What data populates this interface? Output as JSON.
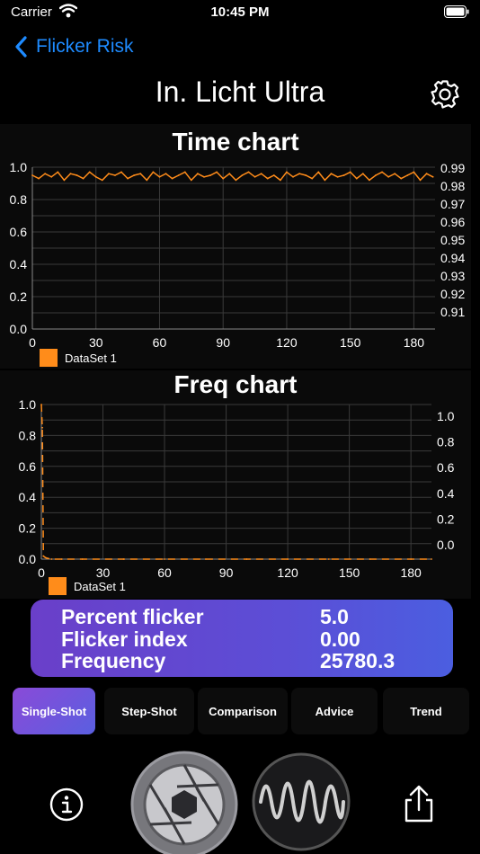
{
  "status": {
    "carrier": "Carrier",
    "time": "10:45 PM"
  },
  "nav": {
    "back_label": "Flicker Risk"
  },
  "title": "In. Licht Ultra",
  "time_chart": {
    "title": "Time chart",
    "left_ticks": [
      "1.0",
      "0.8",
      "0.6",
      "0.4",
      "0.2",
      "0.0"
    ],
    "right_ticks": [
      "0.99",
      "0.98",
      "0.97",
      "0.96",
      "0.95",
      "0.94",
      "0.93",
      "0.92",
      "0.91"
    ],
    "x_ticks": [
      "0",
      "30",
      "60",
      "90",
      "120",
      "150",
      "180"
    ],
    "legend": "DataSet 1"
  },
  "freq_chart": {
    "title": "Freq chart",
    "left_ticks": [
      "1.0",
      "0.8",
      "0.6",
      "0.4",
      "0.2",
      "0.0"
    ],
    "right_ticks": [
      "1.0",
      "0.8",
      "0.6",
      "0.4",
      "0.2",
      "0.0"
    ],
    "x_ticks": [
      "0",
      "30",
      "60",
      "90",
      "120",
      "150",
      "180"
    ],
    "legend": "DataSet 1"
  },
  "metrics": {
    "percent_flicker_label": "Percent flicker",
    "percent_flicker_value": "5.0",
    "flicker_index_label": "Flicker index",
    "flicker_index_value": "0.00",
    "frequency_label": "Frequency",
    "frequency_value": "25780.3"
  },
  "tabs": [
    "Single-Shot",
    "Step-Shot",
    "Comparison",
    "Advice",
    "Trend"
  ],
  "colors": {
    "accent": "#1e8bff",
    "series": "#ff8c1a",
    "metrics_start": "#6a3fc9",
    "metrics_end": "#4b5ee0"
  },
  "chart_data": [
    {
      "type": "line",
      "title": "Time chart",
      "xlim": [
        0,
        190
      ],
      "ylim": [
        0,
        1.0
      ],
      "y2lim": [
        0.905,
        0.995
      ],
      "series": [
        {
          "name": "DataSet 1",
          "x": [
            0,
            3,
            6,
            9,
            12,
            15,
            18,
            21,
            24,
            27,
            30,
            33,
            36,
            39,
            42,
            45,
            48,
            51,
            54,
            57,
            60,
            63,
            66,
            69,
            72,
            75,
            78,
            81,
            84,
            87,
            90,
            93,
            96,
            99,
            102,
            105,
            108,
            111,
            114,
            117,
            120,
            123,
            126,
            129,
            132,
            135,
            138,
            141,
            144,
            147,
            150,
            153,
            156,
            159,
            162,
            165,
            168,
            171,
            174,
            177,
            180,
            183,
            186,
            189
          ],
          "values": [
            0.95,
            0.93,
            0.96,
            0.94,
            0.97,
            0.92,
            0.96,
            0.95,
            0.93,
            0.97,
            0.94,
            0.92,
            0.96,
            0.95,
            0.97,
            0.93,
            0.95,
            0.96,
            0.92,
            0.97,
            0.94,
            0.96,
            0.93,
            0.95,
            0.97,
            0.92,
            0.96,
            0.94,
            0.95,
            0.97,
            0.93,
            0.96,
            0.92,
            0.95,
            0.97,
            0.94,
            0.96,
            0.93,
            0.95,
            0.92,
            0.97,
            0.94,
            0.96,
            0.95,
            0.93,
            0.97,
            0.92,
            0.96,
            0.94,
            0.95,
            0.97,
            0.93,
            0.96,
            0.92,
            0.95,
            0.97,
            0.94,
            0.96,
            0.93,
            0.95,
            0.97,
            0.92,
            0.96,
            0.94
          ]
        }
      ],
      "grid": true,
      "legend": "bottom-left"
    },
    {
      "type": "line",
      "title": "Freq chart",
      "xlim": [
        0,
        190
      ],
      "ylim": [
        0,
        1.0
      ],
      "series": [
        {
          "name": "DataSet 1",
          "x": [
            0,
            0.5,
            1,
            2,
            3,
            5,
            10,
            20,
            40,
            60,
            80,
            100,
            120,
            140,
            160,
            180,
            190
          ],
          "values": [
            1.0,
            0.85,
            0.02,
            0.01,
            0.005,
            0,
            0,
            0,
            0,
            0,
            0,
            0,
            0,
            0,
            0,
            0,
            0
          ]
        }
      ],
      "grid": true,
      "legend": "bottom-left"
    }
  ]
}
